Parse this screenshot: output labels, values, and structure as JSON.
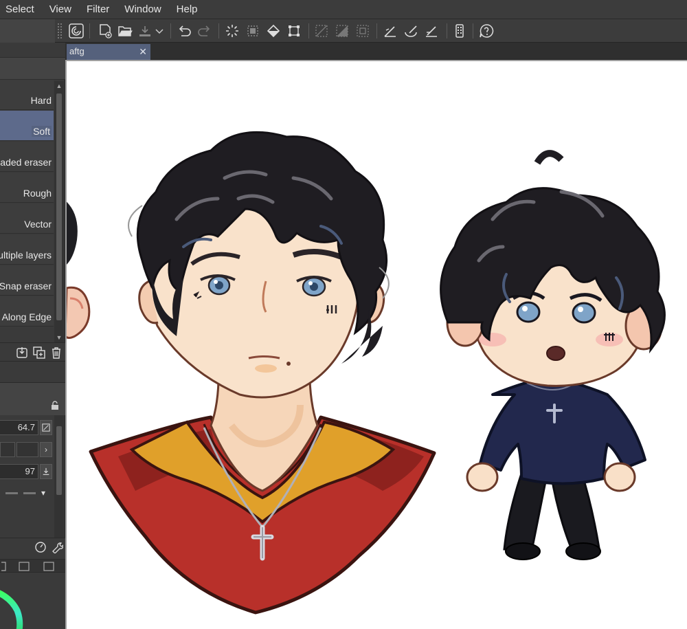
{
  "menu": {
    "items": [
      "Select",
      "View",
      "Filter",
      "Window",
      "Help"
    ]
  },
  "toolbar": {
    "icons": [
      "clip-studio-icon",
      "new-file-icon",
      "open-folder-icon",
      "save-cloud-icon",
      "undo-icon",
      "redo-icon",
      "marquee-icon",
      "selection-crop-icon",
      "fill-icon",
      "transform-icon",
      "clear-selection-icon",
      "invert-selection-icon",
      "show-selection-icon",
      "snap-ruler-icon",
      "snap-special-icon",
      "snap-grid-icon",
      "smartphone-icon",
      "help-icon"
    ]
  },
  "document": {
    "tab_title": "aftg",
    "close_symbol": "✕"
  },
  "sub_tools": {
    "items": [
      {
        "label": "Hard",
        "selected": false
      },
      {
        "label": "Soft",
        "selected": true
      },
      {
        "label": "aded eraser",
        "selected": false
      },
      {
        "label": "Rough",
        "selected": false
      },
      {
        "label": "Vector",
        "selected": false
      },
      {
        "label": "ultiple layers",
        "selected": false
      },
      {
        "label": "Snap eraser",
        "selected": false
      },
      {
        "label": "Along Edge",
        "selected": false
      }
    ]
  },
  "tool_property": {
    "size_value": "64.7",
    "density_value": "97"
  },
  "colors": {
    "accent": "#5d6a8b",
    "panel": "#3a3a3a",
    "menubar": "#3c3c3c",
    "canvas": "#ffffff"
  }
}
